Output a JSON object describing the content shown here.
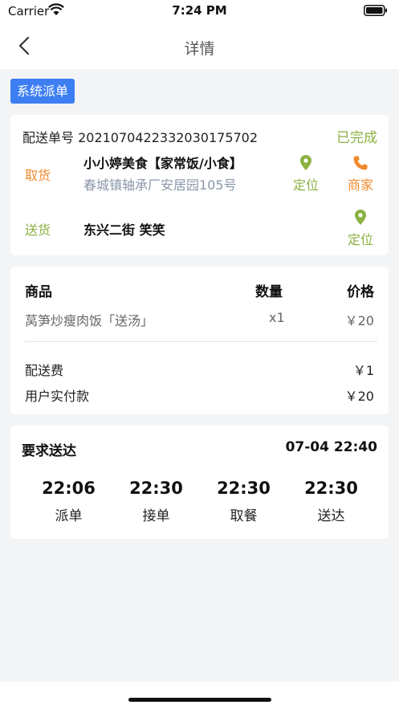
{
  "status_bar": {
    "carrier": "Carrier",
    "time": "7:24 PM"
  },
  "nav": {
    "title": "详情",
    "back_icon": "chevron-left-icon"
  },
  "badge": {
    "label": "系统派单",
    "color": "#3d7ef2"
  },
  "order": {
    "number": "配送单号 20210704223320301757​02",
    "status": "已完成",
    "status_color": "#8bb142",
    "pickup": {
      "label": "取货",
      "shop_name": "小小婷美食【家常饭/小食】",
      "address": "春城镇轴承厂安居园105号",
      "locate_label": "定位",
      "merchant_label": "商家"
    },
    "delivery": {
      "label": "送货",
      "recipient": "东兴二街 笑笑",
      "locate_label": "定位"
    }
  },
  "goods": {
    "headers": {
      "name": "商品",
      "qty": "数量",
      "price": "价格"
    },
    "items": [
      {
        "name": "莴笋炒瘦肉饭「送汤」",
        "qty": "x1",
        "price": "￥20"
      }
    ],
    "delivery_fee_label": "配送费",
    "delivery_fee": "￥1",
    "paid_label": "用户实付款",
    "paid": "￥20"
  },
  "schedule": {
    "required_label": "要求送达",
    "required_time": "07-04 22:40",
    "steps": [
      {
        "time": "22:06",
        "label": "派单"
      },
      {
        "time": "22:30",
        "label": "接单"
      },
      {
        "time": "22:30",
        "label": "取餐"
      },
      {
        "time": "22:30",
        "label": "送达"
      }
    ]
  }
}
